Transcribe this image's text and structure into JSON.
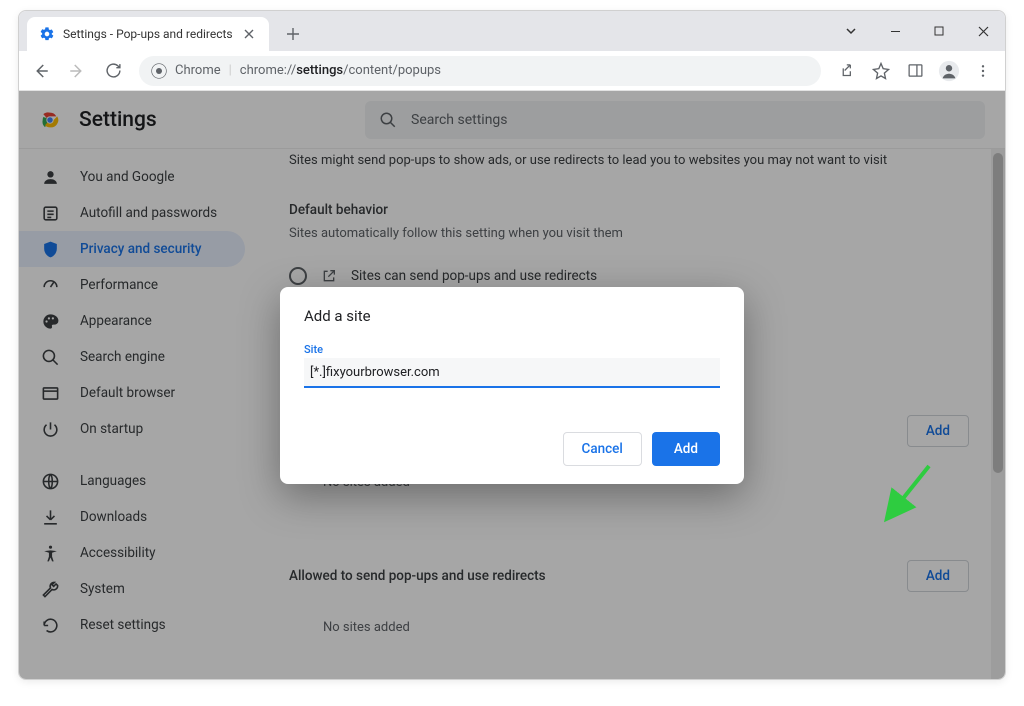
{
  "window": {
    "tab_title": "Settings - Pop-ups and redirects"
  },
  "toolbar": {
    "chrome_label": "Chrome",
    "url_prefix": "chrome://",
    "url_bold": "settings",
    "url_suffix": "/content/popups"
  },
  "settings_header": {
    "title": "Settings",
    "search_placeholder": "Search settings"
  },
  "sidebar": {
    "items": [
      {
        "label": "You and Google",
        "icon": "person"
      },
      {
        "label": "Autofill and passwords",
        "icon": "autofill"
      },
      {
        "label": "Privacy and security",
        "icon": "shield",
        "active": true
      },
      {
        "label": "Performance",
        "icon": "speed"
      },
      {
        "label": "Appearance",
        "icon": "palette"
      },
      {
        "label": "Search engine",
        "icon": "search"
      },
      {
        "label": "Default browser",
        "icon": "browser"
      },
      {
        "label": "On startup",
        "icon": "power"
      },
      {
        "label": "Languages",
        "icon": "globe"
      },
      {
        "label": "Downloads",
        "icon": "download"
      },
      {
        "label": "Accessibility",
        "icon": "accessibility"
      },
      {
        "label": "System",
        "icon": "wrench"
      },
      {
        "label": "Reset settings",
        "icon": "reset"
      }
    ]
  },
  "main": {
    "desc": "Sites might send pop-ups to show ads, or use redirects to lead you to websites you may not want to visit",
    "default_behavior_title": "Default behavior",
    "default_behavior_sub": "Sites automatically follow this setting when you visit them",
    "radio_option": "Sites can send pop-ups and use redirects",
    "not_allowed_nosites": "No sites added",
    "allowed_title": "Allowed to send pop-ups and use redirects",
    "allowed_nosites": "No sites added",
    "add_label": "Add"
  },
  "dialog": {
    "title": "Add a site",
    "field_label": "Site",
    "field_value": "[*.]fixyourbrowser.com",
    "cancel": "Cancel",
    "add": "Add"
  }
}
